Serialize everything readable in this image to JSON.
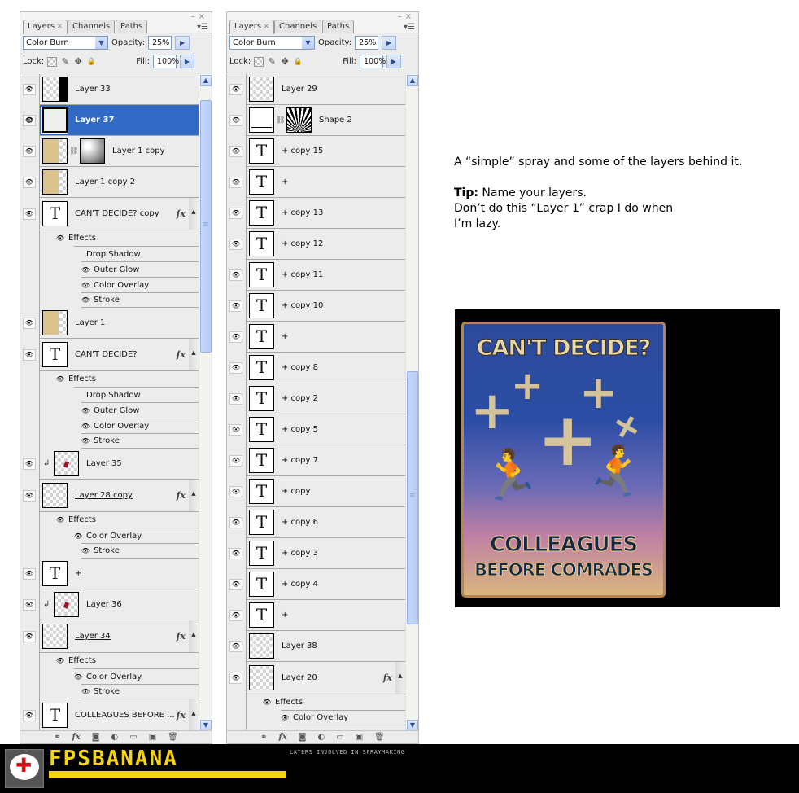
{
  "panels": [
    {
      "tabs": [
        {
          "label": "Layers",
          "close": "×"
        },
        {
          "label": "Channels"
        },
        {
          "label": "Paths"
        }
      ],
      "blend_mode": "Color Burn",
      "opacity_label": "Opacity:",
      "opacity": "25%",
      "lock_label": "Lock:",
      "fill_label": "Fill:",
      "fill": "100%",
      "layers": [
        {
          "name": "Layer 33",
          "thumb": "black-right",
          "visible": true
        },
        {
          "name": "Layer 37",
          "thumb": "blank",
          "visible": true,
          "selected": true
        },
        {
          "name": "Layer 1 copy",
          "thumb": "tan",
          "mask": "grad",
          "visible": true
        },
        {
          "name": "Layer 1 copy 2",
          "thumb": "tan",
          "visible": true
        },
        {
          "name": "CAN'T DECIDE? copy",
          "thumb": "text",
          "fx": true,
          "visible": true,
          "effects_label": "Effects",
          "effects": [
            {
              "name": "Drop Shadow",
              "visible": false
            },
            {
              "name": "Outer Glow",
              "visible": true
            },
            {
              "name": "Color Overlay",
              "visible": true
            },
            {
              "name": "Stroke",
              "visible": true
            }
          ]
        },
        {
          "name": "Layer 1",
          "thumb": "tan",
          "visible": true
        },
        {
          "name": "CAN'T DECIDE?",
          "thumb": "text",
          "fx": true,
          "visible": true,
          "effects_label": "Effects",
          "effects": [
            {
              "name": "Drop Shadow",
              "visible": false
            },
            {
              "name": "Outer Glow",
              "visible": true
            },
            {
              "name": "Color Overlay",
              "visible": true
            },
            {
              "name": "Stroke",
              "visible": true
            }
          ]
        },
        {
          "name": "Layer 35",
          "thumb": "checker-mark",
          "clipped": true,
          "visible": true
        },
        {
          "name": "Layer 28 copy",
          "thumb": "checker",
          "fx": true,
          "underline": true,
          "visible": true,
          "effects_label": "Effects",
          "effects": [
            {
              "name": "Color Overlay",
              "visible": true
            },
            {
              "name": "Stroke",
              "visible": true
            }
          ]
        },
        {
          "name": "+",
          "thumb": "text",
          "visible": true
        },
        {
          "name": "Layer 36",
          "thumb": "checker-mark",
          "clipped": true,
          "visible": true
        },
        {
          "name": "Layer 34",
          "thumb": "checker",
          "fx": true,
          "underline": true,
          "visible": true,
          "effects_label": "Effects",
          "effects": [
            {
              "name": "Color Overlay",
              "visible": true
            },
            {
              "name": "Stroke",
              "visible": true
            }
          ]
        },
        {
          "name": "COLLEAGUES BEFORE ...",
          "thumb": "text",
          "fx": true,
          "visible": true,
          "effects_label": "Effects",
          "effects": []
        }
      ],
      "scroll": {
        "thumb_start": 0.02,
        "thumb_end": 0.42
      }
    },
    {
      "tabs": [
        {
          "label": "Layers",
          "close": "×"
        },
        {
          "label": "Channels"
        },
        {
          "label": "Paths"
        }
      ],
      "blend_mode": "Color Burn",
      "opacity_label": "Opacity:",
      "opacity": "25%",
      "lock_label": "Lock:",
      "fill_label": "Fill:",
      "fill": "100%",
      "layers": [
        {
          "name": "Layer 29",
          "thumb": "checker",
          "visible": true
        },
        {
          "name": "Shape 2",
          "thumb": "vector",
          "mask": "rays",
          "visible": true
        },
        {
          "name": "+ copy 15",
          "thumb": "text",
          "visible": true
        },
        {
          "name": "+",
          "thumb": "text",
          "visible": true
        },
        {
          "name": "+ copy 13",
          "thumb": "text",
          "visible": true
        },
        {
          "name": "+ copy 12",
          "thumb": "text",
          "visible": true
        },
        {
          "name": "+ copy 11",
          "thumb": "text",
          "visible": true
        },
        {
          "name": "+ copy 10",
          "thumb": "text",
          "visible": true
        },
        {
          "name": "+",
          "thumb": "text",
          "visible": true
        },
        {
          "name": "+ copy 8",
          "thumb": "text",
          "visible": true
        },
        {
          "name": "+ copy 2",
          "thumb": "text",
          "visible": true
        },
        {
          "name": "+ copy 5",
          "thumb": "text",
          "visible": true
        },
        {
          "name": "+ copy 7",
          "thumb": "text",
          "visible": true
        },
        {
          "name": "+ copy",
          "thumb": "text",
          "visible": true
        },
        {
          "name": "+ copy 6",
          "thumb": "text",
          "visible": true
        },
        {
          "name": "+ copy 3",
          "thumb": "text",
          "visible": true
        },
        {
          "name": "+ copy 4",
          "thumb": "text",
          "visible": true
        },
        {
          "name": "+",
          "thumb": "text",
          "visible": true
        },
        {
          "name": "Layer 38",
          "thumb": "checker",
          "visible": true
        },
        {
          "name": "Layer 20",
          "thumb": "checker",
          "fx": true,
          "visible": true,
          "effects_label": "Effects",
          "effects": [
            {
              "name": "Color Overlay",
              "visible": true
            }
          ]
        }
      ],
      "scroll": {
        "thumb_start": 0.45,
        "thumb_end": 0.85
      }
    }
  ],
  "footer_icons": [
    "link-icon",
    "fx-icon",
    "mask-icon",
    "adjustment-icon",
    "folder-icon",
    "new-layer-icon",
    "trash-icon"
  ],
  "caption": {
    "line1": "A “simple” spray and some of the layers behind it.",
    "tip_label": "Tip:",
    "tip_text": " Name your layers.",
    "line3": "Don’t do this “Layer 1” crap I do when",
    "line4": "I’m lazy."
  },
  "poster": {
    "title": "CAN'T DECIDE?",
    "subtitle1": "COLLEAGUES",
    "subtitle2": "BEFORE COMRADES"
  },
  "banner": {
    "logo": "FPSBANANA",
    "tagline": "LAYERS INVOLVED IN SPRAYMAKING",
    "brand_color": "#f6d411"
  }
}
